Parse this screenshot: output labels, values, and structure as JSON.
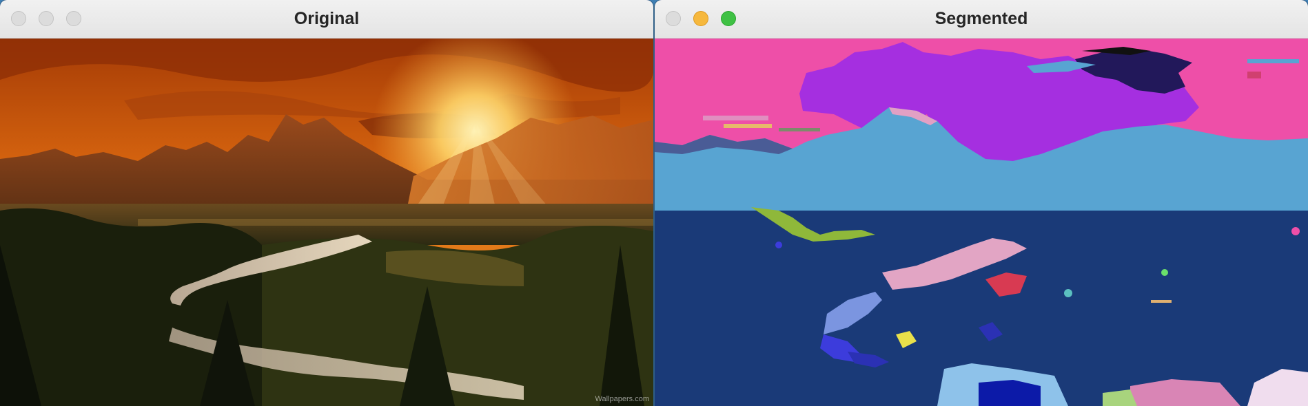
{
  "windows": {
    "left": {
      "title": "Original",
      "controls": [
        "close",
        "minimize",
        "zoom"
      ],
      "content": "sunset-mountain-river-photo"
    },
    "right": {
      "title": "Segmented",
      "controls": [
        "close",
        "minimize",
        "zoom"
      ],
      "content": "segmentation-color-map"
    }
  },
  "colors": {
    "sky_pink": "#ee4fa8",
    "segment_purple": "#a52fe0",
    "mountain_blue": "#58a4d2",
    "ground_navy": "#1a3a78",
    "minimize_yellow": "#f6b83d",
    "zoom_green": "#3fc144"
  }
}
